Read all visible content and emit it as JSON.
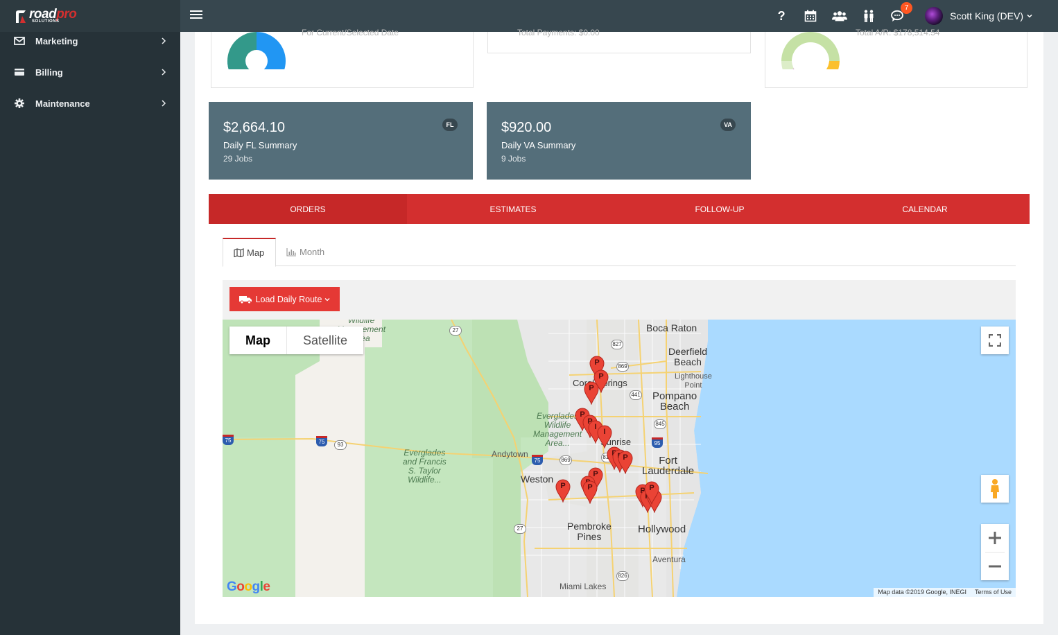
{
  "brand": {
    "name_a": "road",
    "name_b": "pro",
    "sub": "SOLUTIONS"
  },
  "header": {
    "icons": [
      "help-icon",
      "calendar-icon",
      "users-icon",
      "people-icon",
      "chat-icon"
    ],
    "help_glyph": "?",
    "chat_badge": "7",
    "user_name": "Scott King (DEV)"
  },
  "sidebar": {
    "items": [
      {
        "label": "Marketing",
        "icon": "envelope-icon"
      },
      {
        "label": "Billing",
        "icon": "credit-card-icon"
      },
      {
        "label": "Maintenance",
        "icon": "gear-icon"
      }
    ]
  },
  "top_cards": {
    "card1_caption": "For Current/Selected Date",
    "card2_caption": "Total Payments: $0.00",
    "card3_caption": "Total A/R: $178,514.54"
  },
  "summaries": [
    {
      "amount": "$2,664.10",
      "label": "Daily FL Summary",
      "jobs": "29 Jobs",
      "badge": "FL"
    },
    {
      "amount": "$920.00",
      "label": "Daily VA Summary",
      "jobs": "9 Jobs",
      "badge": "VA"
    }
  ],
  "tabs": [
    "ORDERS",
    "ESTIMATES",
    "FOLLOW-UP",
    "CALENDAR"
  ],
  "active_tab": "ORDERS",
  "subtabs": [
    {
      "label": "Map",
      "icon": "map-icon"
    },
    {
      "label": "Month",
      "icon": "bar-chart-icon"
    }
  ],
  "route_button": "Load Daily Route",
  "map": {
    "type_buttons": [
      "Map",
      "Satellite"
    ],
    "cities": {
      "boca_raton": "Boca Raton",
      "deerfield": "Deerfield\nBeach",
      "lighthouse": "Lighthouse\nPoint",
      "pompano": "Pompano\nBeach",
      "coral_springs": "Coral Springs",
      "sunrise": "Sunrise",
      "fort_lauderdale": "Fort\nLauderdale",
      "weston": "Weston",
      "andytown": "Andytown",
      "pembroke": "Pembroke\nPines",
      "hollywood": "Hollywood",
      "aventura": "Aventura",
      "miami_lakes": "Miami Lakes"
    },
    "parks": {
      "wildlife_top": "Wildlife\nManagement\nArea",
      "everglades_wildlife": "Everglades\nWildlife\nManagement\nArea...",
      "everglades_taylor": "Everglades\nand Francis\nS. Taylor\nWildlife..."
    },
    "shields": {
      "s27a": "27",
      "s827": "827",
      "s869a": "869",
      "s441": "441",
      "s845": "845",
      "s817": "817",
      "s869b": "869",
      "s93": "93",
      "s27b": "27",
      "s826": "826",
      "i75a": "75",
      "i75b": "75",
      "i75c": "75",
      "i95": "95"
    },
    "pins": [
      "P",
      "P",
      "P",
      "P",
      "P",
      "I",
      "I",
      "P",
      "P",
      "P",
      "P",
      "P",
      "P",
      "P",
      "P",
      "P",
      "P",
      "P"
    ],
    "google": [
      "G",
      "o",
      "o",
      "g",
      "l",
      "e"
    ],
    "attribution": "Map data ©2019 Google, INEGI",
    "terms": "Terms of Use"
  },
  "colors": {
    "header": "#37474f",
    "sidebar": "#263238",
    "summary_card": "#546e7a",
    "tab_bar": "#d32f2f",
    "tab_active": "#c62828",
    "route_button": "#e53935",
    "pin": "#ea4335"
  }
}
